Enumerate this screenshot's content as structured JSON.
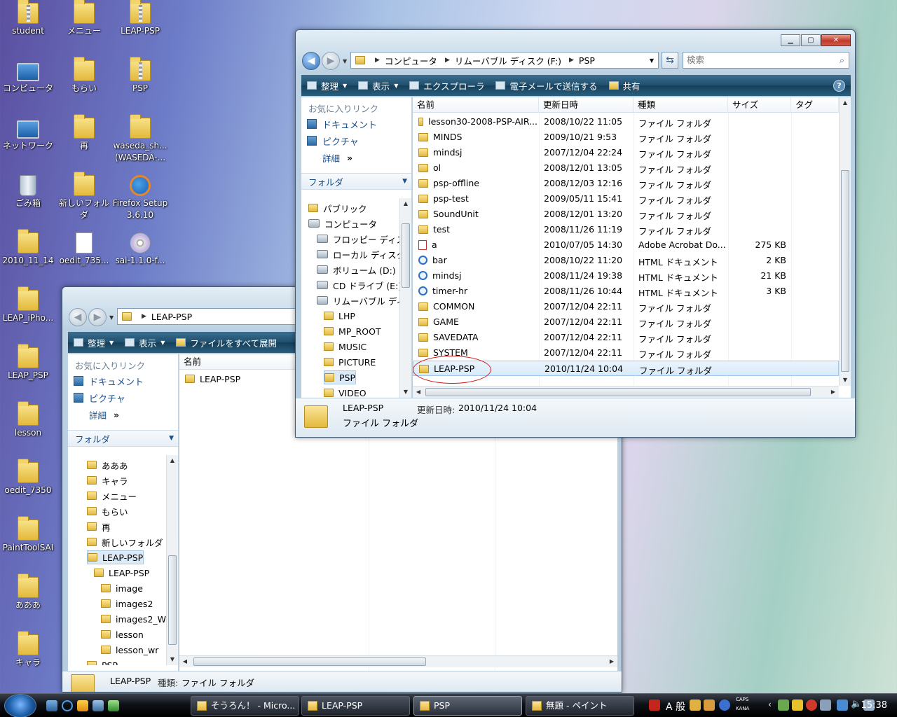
{
  "desktop": {
    "icons": [
      {
        "label": "student"
      },
      {
        "label": "メニュー"
      },
      {
        "label": "LEAP-PSP"
      },
      {
        "label": "コンピュータ"
      },
      {
        "label": "もらい"
      },
      {
        "label": "PSP"
      },
      {
        "label": "ネットワーク"
      },
      {
        "label": "再"
      },
      {
        "label": "waseda_sh... (WASEDA-..."
      },
      {
        "label": "ごみ箱"
      },
      {
        "label": "新しいフォルダ"
      },
      {
        "label": "Firefox Setup 3.6.10"
      },
      {
        "label": "2010_11_14"
      },
      {
        "label": "oedit_735..."
      },
      {
        "label": "sai-1.1.0-f..."
      },
      {
        "label": "LEAP_iPho..."
      },
      {
        "label": "LEAP_PSP"
      },
      {
        "label": "lesson"
      },
      {
        "label": "oedit_7350"
      },
      {
        "label": "PaintToolSAI"
      },
      {
        "label": "あああ"
      },
      {
        "label": "キャラ"
      }
    ]
  },
  "back_window": {
    "address": {
      "crumbs": [
        "LEAP-PSP"
      ]
    },
    "cmdbar": {
      "organize": "整理",
      "view": "表示",
      "expand_all": "ファイルをすべて展開"
    },
    "favorites_header": "お気に入りリンク",
    "favorites": [
      "ドキュメント",
      "ピクチャ"
    ],
    "detail_link": "詳細",
    "folders_label": "フォルダ",
    "tree": [
      "あああ",
      "キャラ",
      "メニュー",
      "もらい",
      "再",
      "新しいフォルダ",
      "LEAP-PSP",
      "LEAP-PSP",
      "image",
      "images2",
      "images2_W",
      "lesson",
      "lesson_wr",
      "PSP"
    ],
    "col_name": "名前",
    "files": [
      "LEAP-PSP"
    ],
    "status": {
      "name": "LEAP-PSP",
      "type_label": "種類:",
      "type_value": "ファイル フォルダ"
    }
  },
  "front_window": {
    "address": {
      "crumbs": [
        "コンピュータ",
        "リムーバブル ディスク (F:)",
        "PSP"
      ]
    },
    "search_placeholder": "検索",
    "cmdbar": {
      "organize": "整理",
      "view": "表示",
      "explorer": "エクスプローラ",
      "email": "電子メールで送信する",
      "share": "共有"
    },
    "favorites_header": "お気に入りリンク",
    "favorites": [
      "ドキュメント",
      "ピクチャ"
    ],
    "detail_link": "詳細",
    "folders_label": "フォルダ",
    "tree": [
      "パブリック",
      "コンピュータ",
      "フロッピー ディスク",
      "ローカル ディスク",
      "ボリューム (D:)",
      "CD ドライブ (E:)",
      "リムーバブル ディ",
      "LHP",
      "MP_ROOT",
      "MUSIC",
      "PICTURE",
      "PSP",
      "VIDEO"
    ],
    "columns": {
      "name": "名前",
      "date": "更新日時",
      "type": "種類",
      "size": "サイズ",
      "tag": "タグ"
    },
    "files": [
      {
        "name": "lesson30-2008-PSP-AIR...",
        "date": "2008/10/22 11:05",
        "type": "ファイル フォルダ",
        "size": "",
        "icon": "folder"
      },
      {
        "name": "MINDS",
        "date": "2009/10/21 9:53",
        "type": "ファイル フォルダ",
        "size": "",
        "icon": "folder"
      },
      {
        "name": "mindsj",
        "date": "2007/12/04 22:24",
        "type": "ファイル フォルダ",
        "size": "",
        "icon": "folder"
      },
      {
        "name": "ol",
        "date": "2008/12/01 13:05",
        "type": "ファイル フォルダ",
        "size": "",
        "icon": "folder"
      },
      {
        "name": "psp-offline",
        "date": "2008/12/03 12:16",
        "type": "ファイル フォルダ",
        "size": "",
        "icon": "folder"
      },
      {
        "name": "psp-test",
        "date": "2009/05/11 15:41",
        "type": "ファイル フォルダ",
        "size": "",
        "icon": "folder"
      },
      {
        "name": "SoundUnit",
        "date": "2008/12/01 13:20",
        "type": "ファイル フォルダ",
        "size": "",
        "icon": "folder"
      },
      {
        "name": "test",
        "date": "2008/11/26 11:19",
        "type": "ファイル フォルダ",
        "size": "",
        "icon": "folder"
      },
      {
        "name": "a",
        "date": "2010/07/05 14:30",
        "type": "Adobe Acrobat Do...",
        "size": "275 KB",
        "icon": "pdf"
      },
      {
        "name": "bar",
        "date": "2008/10/22 11:20",
        "type": "HTML ドキュメント",
        "size": "2 KB",
        "icon": "ie"
      },
      {
        "name": "mindsj",
        "date": "2008/11/24 19:38",
        "type": "HTML ドキュメント",
        "size": "21 KB",
        "icon": "ie"
      },
      {
        "name": "timer-hr",
        "date": "2008/11/26 10:44",
        "type": "HTML ドキュメント",
        "size": "3 KB",
        "icon": "ie"
      },
      {
        "name": "COMMON",
        "date": "2007/12/04 22:11",
        "type": "ファイル フォルダ",
        "size": "",
        "icon": "folder"
      },
      {
        "name": "GAME",
        "date": "2007/12/04 22:11",
        "type": "ファイル フォルダ",
        "size": "",
        "icon": "folder"
      },
      {
        "name": "SAVEDATA",
        "date": "2007/12/04 22:11",
        "type": "ファイル フォルダ",
        "size": "",
        "icon": "folder"
      },
      {
        "name": "SYSTEM",
        "date": "2007/12/04 22:11",
        "type": "ファイル フォルダ",
        "size": "",
        "icon": "folder"
      },
      {
        "name": "LEAP-PSP",
        "date": "2010/11/24 10:04",
        "type": "ファイル フォルダ",
        "size": "",
        "icon": "folder"
      }
    ],
    "selected_file": "LEAP-PSP",
    "status": {
      "name": "LEAP-PSP",
      "modified_label": "更新日時:",
      "modified_value": "2010/11/24 10:04",
      "type": "ファイル フォルダ"
    }
  },
  "taskbar": {
    "buttons": [
      "そうろん！ - Micro...",
      "LEAP-PSP",
      "PSP",
      "無題 - ペイント"
    ],
    "active": "PSP",
    "ime": "A 般",
    "caps": "CAPS",
    "kana": "KANA",
    "clock": "15:38"
  }
}
